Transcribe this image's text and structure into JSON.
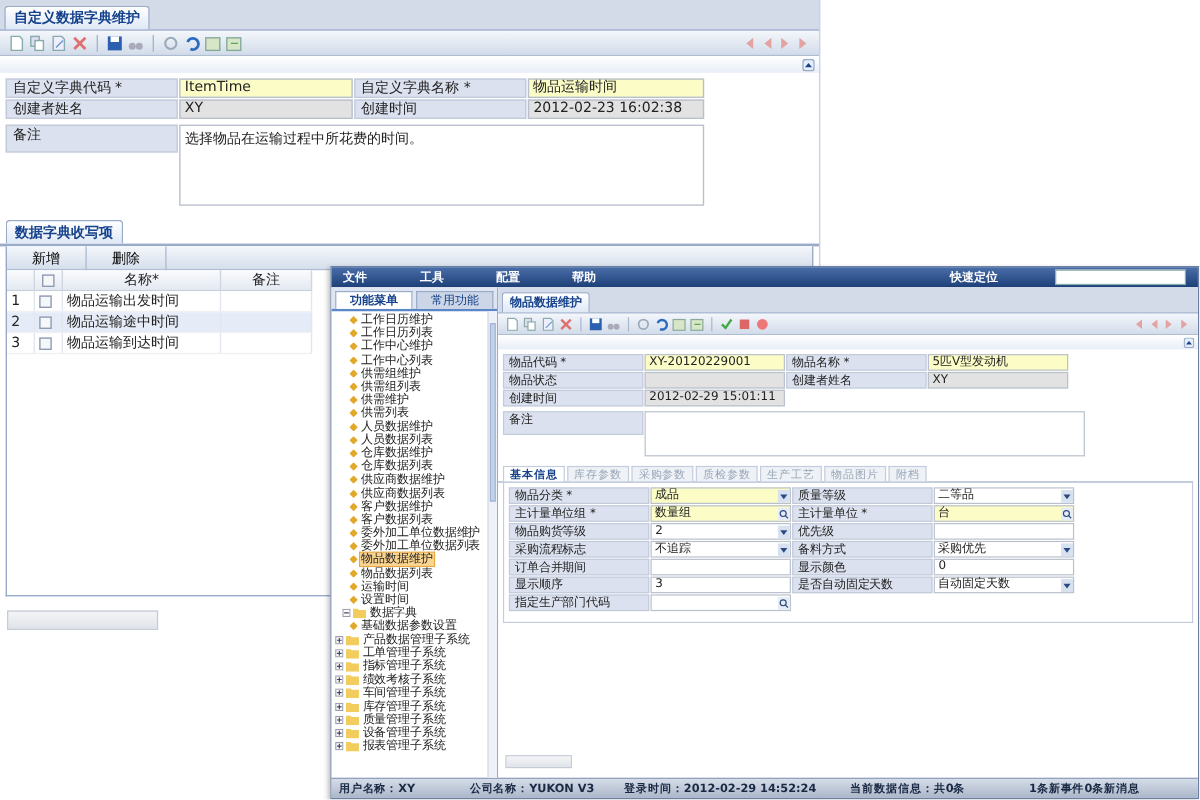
{
  "main": {
    "tab": {
      "label": "自定义数据字典维护",
      "selected": true
    },
    "fields": [
      {
        "label": "自定义字典代码 *",
        "value": "ItemTime",
        "kind": "required"
      },
      {
        "label": "自定义字典名称 *",
        "value": "物品运输时间",
        "kind": "required"
      },
      {
        "label": "创建者姓名",
        "value": "XY",
        "kind": "readonly"
      },
      {
        "label": "创建时间",
        "value": "2012-02-23 16:02:38",
        "kind": "readonly"
      }
    ],
    "remark": {
      "label": "备注",
      "value": "选择物品在运输过程中所花费的时间。"
    },
    "detail_tab": {
      "label": "数据字典收写项",
      "selected": true
    },
    "buttons": [
      "新增",
      "删除"
    ],
    "table": {
      "columns": [
        "名称*",
        "备注"
      ],
      "all_checked": false,
      "rows": [
        {
          "index": "1",
          "checked": false,
          "name": "物品运输出发时间",
          "selected": false
        },
        {
          "index": "2",
          "checked": false,
          "name": "物品运输途中时间",
          "selected": true
        },
        {
          "index": "3",
          "checked": false,
          "name": "物品运输到达时间",
          "selected": false
        }
      ]
    }
  },
  "inset": {
    "menu": [
      "文件",
      "工具",
      "配置",
      "帮助"
    ],
    "quick_search": {
      "label": "快速定位"
    },
    "side_tabs": [
      {
        "label": "功能菜单",
        "selected": true
      },
      {
        "label": "常用功能",
        "selected": false
      }
    ],
    "tree": [
      {
        "children": [
          {
            "children": [
              {
                "label": "工作日历维护",
                "selected": false
              },
              {
                "label": "工作日历列表",
                "selected": false
              },
              {
                "label": "工作中心维护",
                "selected": false
              },
              {
                "label": "工作中心列表",
                "selected": false
              },
              {
                "label": "供需组维护",
                "selected": false
              },
              {
                "label": "供需组列表",
                "selected": false
              },
              {
                "label": "供需维护",
                "selected": false
              },
              {
                "label": "供需列表",
                "selected": false
              },
              {
                "label": "人员数据维护",
                "selected": false
              },
              {
                "label": "人员数据列表",
                "selected": false
              },
              {
                "label": "仓库数据维护",
                "selected": false
              },
              {
                "label": "仓库数据列表",
                "selected": false
              },
              {
                "label": "供应商数据维护",
                "selected": false
              },
              {
                "label": "供应商数据列表",
                "selected": false
              },
              {
                "label": "客户数据维护",
                "selected": false
              },
              {
                "label": "客户数据列表",
                "selected": false
              },
              {
                "label": "委外加工单位数据维护",
                "selected": false
              },
              {
                "label": "委外加工单位数据列表",
                "selected": false
              },
              {
                "label": "物品数据维护",
                "selected": true
              },
              {
                "label": "物品数据列表",
                "selected": false
              },
              {
                "label": "运输时间",
                "selected": false
              },
              {
                "label": "设置时间",
                "selected": false
              }
            ]
          },
          {
            "label": "数据字典",
            "kind": "folder",
            "expanded": true,
            "children": [
              {
                "label": "基础数据参数设置",
                "selected": false
              }
            ]
          }
        ]
      },
      {
        "label": "产品数据管理子系统",
        "kind": "folder",
        "expanded": false
      },
      {
        "label": "工单管理子系统",
        "kind": "folder",
        "expanded": false
      },
      {
        "label": "指标管理子系统",
        "kind": "folder",
        "expanded": false
      },
      {
        "label": "绩效考核子系统",
        "kind": "folder",
        "expanded": false
      },
      {
        "label": "车间管理子系统",
        "kind": "folder",
        "expanded": false
      },
      {
        "label": "库存管理子系统",
        "kind": "folder",
        "expanded": false
      },
      {
        "label": "质量管理子系统",
        "kind": "folder",
        "expanded": false
      },
      {
        "label": "设备管理子系统",
        "kind": "folder",
        "expanded": false
      },
      {
        "label": "报表管理子系统",
        "kind": "folder",
        "expanded": false
      }
    ],
    "tab": {
      "label": "物品数据维护",
      "selected": true
    },
    "fields": [
      {
        "label": "物品代码 *",
        "value": "XY-20120229001",
        "kind": "required"
      },
      {
        "label": "物品名称 *",
        "value": "5匹V型发动机",
        "kind": "required"
      },
      {
        "label": "物品状态",
        "kind": "readonly"
      },
      {
        "label": "创建者姓名",
        "value": "XY",
        "kind": "readonly"
      },
      {
        "label": "创建时间",
        "value": "2012-02-29 15:01:11",
        "kind": "readonly"
      }
    ],
    "remark": {
      "label": "备注"
    },
    "sub_tabs": [
      {
        "label": "基本信息",
        "selected": true
      },
      {
        "label": "库存参数",
        "selected": false
      },
      {
        "label": "采购参数",
        "selected": false
      },
      {
        "label": "质检参数",
        "selected": false
      },
      {
        "label": "生产工艺",
        "selected": false
      },
      {
        "label": "物品图片",
        "selected": false
      },
      {
        "label": "附档",
        "selected": false
      }
    ],
    "grid": [
      {
        "label": "物品分类 *",
        "value": "成品",
        "kind": "select",
        "required": true
      },
      {
        "label": "质量等级",
        "value": "二等品",
        "kind": "select",
        "required": false
      },
      {
        "label": "主计量单位组 *",
        "value": "数量组",
        "kind": "lookup",
        "required": true
      },
      {
        "label": "主计量单位 *",
        "value": "台",
        "kind": "lookup",
        "required": true
      },
      {
        "label": "物品购货等级",
        "value": "2",
        "kind": "select",
        "required": false
      },
      {
        "label": "优先级",
        "kind": "text",
        "required": false
      },
      {
        "label": "采购流程标志",
        "value": "不追踪",
        "kind": "select",
        "required": false
      },
      {
        "label": "备料方式",
        "value": "采购优先",
        "kind": "select",
        "required": false
      },
      {
        "label": "订单合并期间",
        "kind": "text",
        "required": false
      },
      {
        "label": "显示颜色",
        "value": "0",
        "kind": "text",
        "required": false
      },
      {
        "label": "显示顺序",
        "value": "3",
        "kind": "text",
        "required": false
      },
      {
        "label": "是否自动固定天数",
        "value": "自动固定天数",
        "kind": "select",
        "required": false
      },
      {
        "label": "指定生产部门代码",
        "kind": "lookup",
        "required": false
      }
    ],
    "status_bar": [
      "用户名称：XY",
      "公司名称：YUKON V3",
      "登录时间：2012-02-29 14:52:24",
      "当前数据信息：共0条",
      "1条新事件0条新消息"
    ]
  }
}
